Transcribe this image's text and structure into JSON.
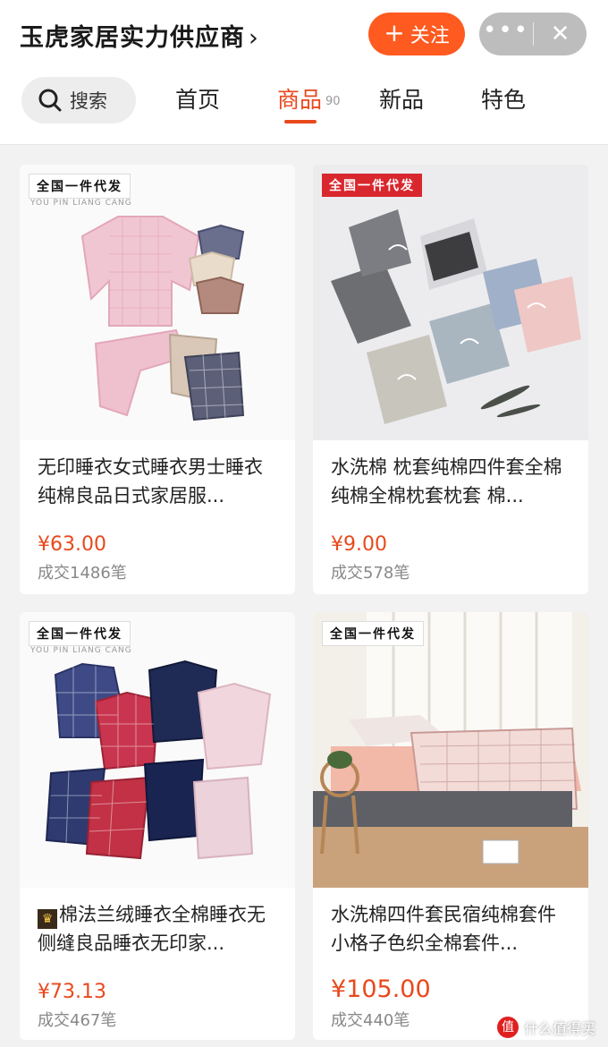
{
  "header": {
    "shop_name": "玉虎家居实力供应商",
    "chevron": "›",
    "follow_plus": "+",
    "follow_label": "关注",
    "more_icon": "•••",
    "close_icon": "✕"
  },
  "nav": {
    "search_label": "搜索",
    "tabs": [
      {
        "label": "首页"
      },
      {
        "label": "商品",
        "count": "90",
        "active": true
      },
      {
        "label": "新品"
      },
      {
        "label": "特色"
      }
    ]
  },
  "products": [
    {
      "badge": "全国一件代发",
      "brand_sub": "YOU PIN LIANG CANG",
      "title": "无印睡衣女式睡衣男士睡衣纯棉良品日式家居服...",
      "price": "¥63.00",
      "sold": "成交1486笔"
    },
    {
      "badge": "全国一件代发",
      "title": "水洗棉 枕套纯棉四件套全棉纯棉全棉枕套枕套 棉...",
      "price": "¥9.00",
      "sold": "成交578笔"
    },
    {
      "badge": "全国一件代发",
      "brand_sub": "YOU PIN LIANG CANG",
      "title": "棉法兰绒睡衣全棉睡衣无侧缝良品睡衣无印家...",
      "price": "¥73.13",
      "sold": "成交467笔"
    },
    {
      "badge": "全国一件代发",
      "title": "水洗棉四件套民宿纯棉套件小格子色织全棉套件...",
      "price": "¥105.00",
      "sold": "成交440笔"
    }
  ],
  "watermark": {
    "logo": "值",
    "text": "什么值得买"
  },
  "colors": {
    "accent": "#e8491d",
    "follow": "#ff5a1f",
    "badge_red": "#d9272e"
  }
}
